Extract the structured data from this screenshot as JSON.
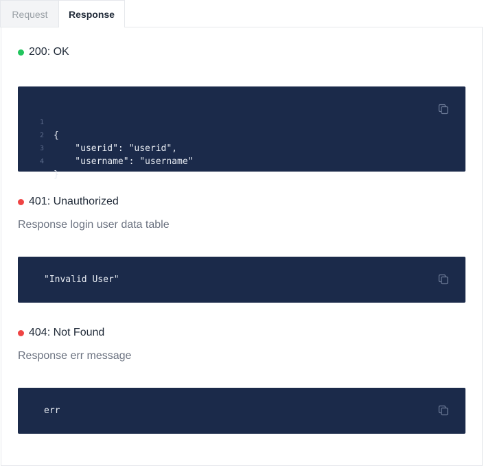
{
  "tabs": {
    "request_label": "Request",
    "response_label": "Response",
    "active": "Response"
  },
  "responses": [
    {
      "status": "200: OK",
      "status_color": "#22c55e",
      "description": "",
      "code_lines": [
        {
          "num": "1",
          "text": "{"
        },
        {
          "num": "2",
          "text": "    \"userid\": \"userid\","
        },
        {
          "num": "3",
          "text": "    \"username\": \"username\""
        },
        {
          "num": "4",
          "text": "}"
        }
      ]
    },
    {
      "status": "401: Unauthorized",
      "status_color": "#ef4444",
      "description": "Response login user data table",
      "code": "\"Invalid User\""
    },
    {
      "status": "404: Not Found",
      "status_color": "#ef4444",
      "description": "Response err message",
      "code": "err"
    }
  ],
  "colors": {
    "code_background": "#1b2a4a",
    "success": "#22c55e",
    "error": "#ef4444"
  },
  "icons": {
    "copy": "copy-icon"
  }
}
